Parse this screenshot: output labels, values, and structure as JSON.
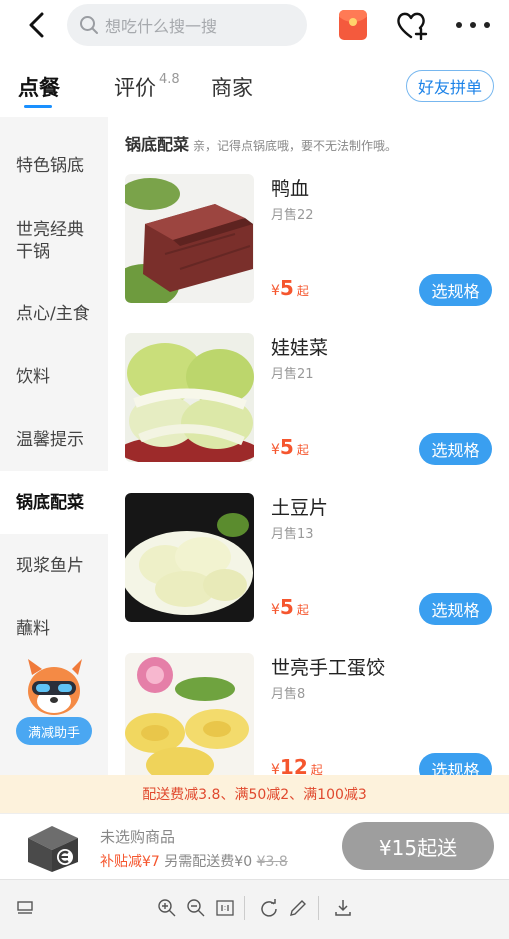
{
  "search": {
    "placeholder": "想吃什么搜一搜"
  },
  "tabs": {
    "order": "点餐",
    "reviews": "评价",
    "rating": "4.8",
    "merchant": "商家",
    "friends": "好友拼单"
  },
  "sidebar": {
    "items": [
      "特色锅底",
      "世亮经典干锅",
      "点心/主食",
      "饮料",
      "温馨提示",
      "锅底配菜",
      "现浆鱼片",
      "蘸料"
    ],
    "active": "锅底配菜",
    "helper": "满减助手"
  },
  "section": {
    "title": "锅底配菜",
    "note": "亲，记得点锅底哦，要不无法制作哦。"
  },
  "products": [
    {
      "name": "鸭血",
      "sales": "月售22",
      "currency": "¥",
      "price": "5",
      "suffix": "起",
      "button": "选规格"
    },
    {
      "name": "娃娃菜",
      "sales": "月售21",
      "currency": "¥",
      "price": "5",
      "suffix": "起",
      "button": "选规格"
    },
    {
      "name": "土豆片",
      "sales": "月售13",
      "currency": "¥",
      "price": "5",
      "suffix": "起",
      "button": "选规格"
    },
    {
      "name": "世亮手工蛋饺",
      "sales": "月售8",
      "currency": "¥",
      "price": "12",
      "suffix": "起",
      "button": "选规格"
    }
  ],
  "promo": "配送费减3.8、满50减2、满100减3",
  "cart": {
    "empty": "未选购商品",
    "subsidy": "补贴减¥7",
    "delivery": "另需配送费¥0",
    "original_fee": "¥3.8",
    "send": "¥15起送"
  },
  "colors": {
    "accent": "#3a9ff0",
    "price": "#f5562e",
    "promo_bg": "#fdf2dc"
  }
}
